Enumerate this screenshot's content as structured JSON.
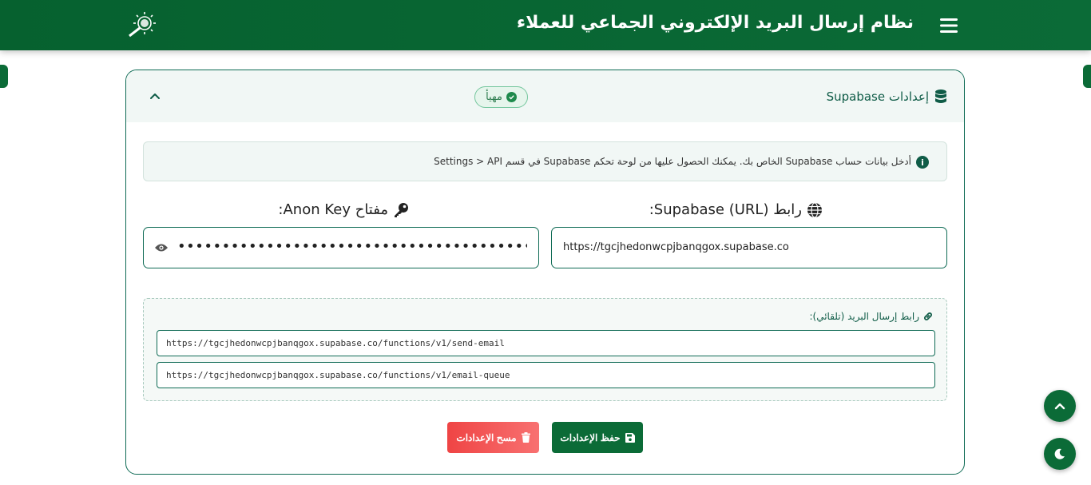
{
  "header": {
    "title": "نظام إرسال البريد الإلكتروني الجماعي للعملاء",
    "menu_icon": "hamburger-icon",
    "logo_icon": "sun-magnifier-logo"
  },
  "card": {
    "title": "إعدادات Supabase",
    "title_icon": "database-icon",
    "collapse_icon": "chevron-up-icon",
    "status_badge": "مهيأ",
    "status_icon": "check-circle-icon"
  },
  "info": {
    "text": "أدخل بيانات حساب Supabase الخاص بك. يمكنك الحصول عليها من لوحة تحكم Supabase في قسم Settings > API",
    "icon": "info-icon"
  },
  "url_field": {
    "label": "رابط Supabase (URL):",
    "label_icon": "globe-icon",
    "value": "https://tgcjhedonwcpjbanqgox.supabase.co"
  },
  "key_field": {
    "label": "مفتاح Anon Key:",
    "label_icon": "key-icon",
    "value": "••••••••••••••••••••••••••••••••••••••••••••••••••••••••••••••••••••••••••••••",
    "toggle_icon": "eye-icon"
  },
  "email_links": {
    "label": "رابط إرسال البريد (تلقائي):",
    "label_icon": "link-icon",
    "send_email_url": "https://tgcjhedonwcpjbanqgox.supabase.co/functions/v1/send-email",
    "email_queue_url": "https://tgcjhedonwcpjbanqgox.supabase.co/functions/v1/email-queue"
  },
  "buttons": {
    "save_label": "حفظ الإعدادات",
    "save_icon": "floppy-disk-icon",
    "clear_label": "مسح الإعدادات",
    "clear_icon": "trash-icon"
  },
  "floating": {
    "scroll_top_icon": "chevron-up-icon",
    "theme_icon": "moon-icon"
  },
  "colors": {
    "primary": "#0b6b37",
    "danger": "#ef4444",
    "success_badge": "#e6f5ec"
  }
}
